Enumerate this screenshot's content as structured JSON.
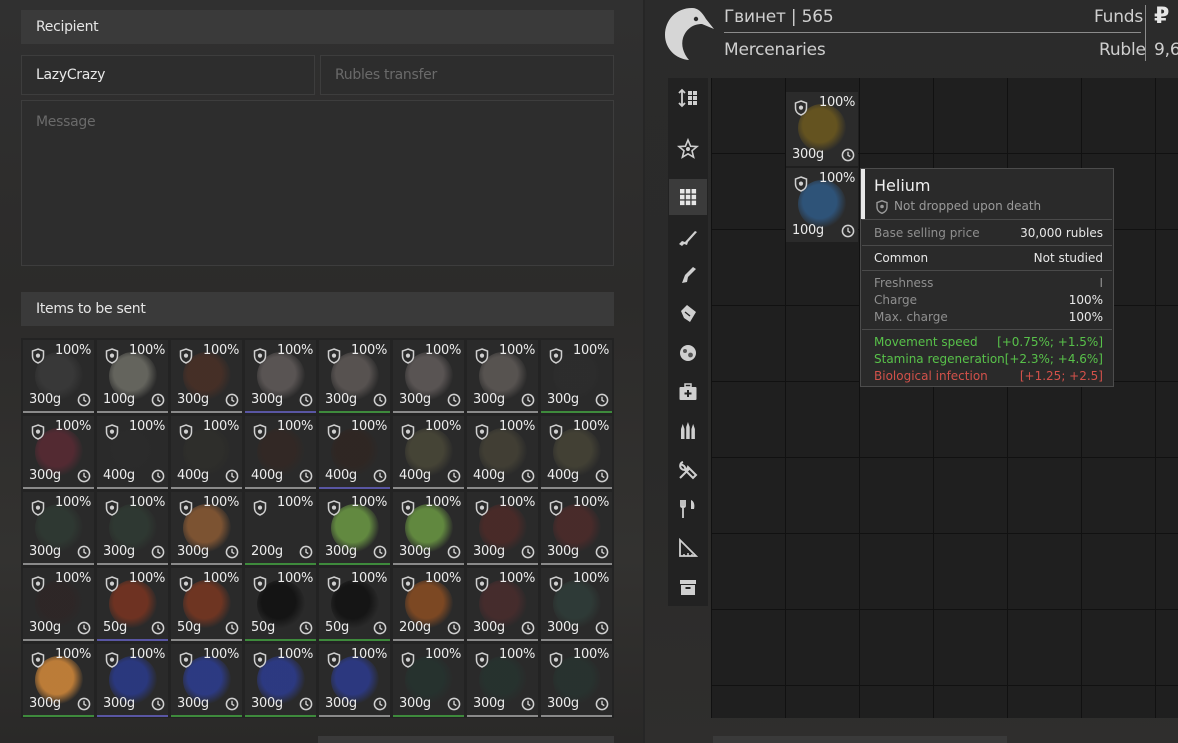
{
  "recipient": {
    "header": "Recipient",
    "username": "LazyCrazy",
    "rubles_placeholder": "Rubles transfer",
    "message_placeholder": "Message"
  },
  "items_to_send": {
    "header": "Items to be sent",
    "items": [
      {
        "pct": "100%",
        "weight": "300g",
        "color": "#3a3a3a",
        "edge": "gray"
      },
      {
        "pct": "100%",
        "weight": "100g",
        "color": "#6e6e66",
        "edge": "gray"
      },
      {
        "pct": "100%",
        "weight": "300g",
        "color": "#4a3026",
        "edge": "gray"
      },
      {
        "pct": "100%",
        "weight": "300g",
        "color": "#615b5a",
        "edge": "purple"
      },
      {
        "pct": "100%",
        "weight": "300g",
        "color": "#5f5957",
        "edge": "green"
      },
      {
        "pct": "100%",
        "weight": "300g",
        "color": "#615b5a",
        "edge": "gray"
      },
      {
        "pct": "100%",
        "weight": "300g",
        "color": "#5f5a57",
        "edge": "gray"
      },
      {
        "pct": "100%",
        "weight": "300g",
        "color": "#2d2d2d",
        "edge": "green"
      },
      {
        "pct": "100%",
        "weight": "300g",
        "color": "#5a2a34",
        "edge": "gray"
      },
      {
        "pct": "100%",
        "weight": "400g",
        "color": "#2b2b2b",
        "edge": "gray"
      },
      {
        "pct": "100%",
        "weight": "400g",
        "color": "#2f2f2b",
        "edge": "gray"
      },
      {
        "pct": "100%",
        "weight": "400g",
        "color": "#332824",
        "edge": "gray"
      },
      {
        "pct": "100%",
        "weight": "400g",
        "color": "#302622",
        "edge": "purple"
      },
      {
        "pct": "100%",
        "weight": "400g",
        "color": "#4a4838",
        "edge": "gray"
      },
      {
        "pct": "100%",
        "weight": "400g",
        "color": "#454236",
        "edge": "gray"
      },
      {
        "pct": "100%",
        "weight": "400g",
        "color": "#464436",
        "edge": "gray"
      },
      {
        "pct": "100%",
        "weight": "300g",
        "color": "#2f3a33",
        "edge": "gray"
      },
      {
        "pct": "100%",
        "weight": "300g",
        "color": "#2f3b33",
        "edge": "gray"
      },
      {
        "pct": "100%",
        "weight": "300g",
        "color": "#8a5a34",
        "edge": "gray"
      },
      {
        "pct": "100%",
        "weight": "200g",
        "color": "#2a2a2a",
        "edge": "green"
      },
      {
        "pct": "100%",
        "weight": "300g",
        "color": "#6c9a44",
        "edge": "green"
      },
      {
        "pct": "100%",
        "weight": "300g",
        "color": "#6b9843",
        "edge": "gray"
      },
      {
        "pct": "100%",
        "weight": "300g",
        "color": "#4e2a28",
        "edge": "gray"
      },
      {
        "pct": "100%",
        "weight": "300g",
        "color": "#4e2b2a",
        "edge": "gray"
      },
      {
        "pct": "100%",
        "weight": "300g",
        "color": "#2e2626",
        "edge": "gray"
      },
      {
        "pct": "100%",
        "weight": "50g",
        "color": "#7a3420",
        "edge": "purple"
      },
      {
        "pct": "100%",
        "weight": "50g",
        "color": "#7a3721",
        "edge": "gray"
      },
      {
        "pct": "100%",
        "weight": "50g",
        "color": "#101010",
        "edge": "green"
      },
      {
        "pct": "100%",
        "weight": "50g",
        "color": "#111111",
        "edge": "green"
      },
      {
        "pct": "100%",
        "weight": "200g",
        "color": "#8a4d22",
        "edge": "gray"
      },
      {
        "pct": "100%",
        "weight": "300g",
        "color": "#4a2c2d",
        "edge": "gray"
      },
      {
        "pct": "100%",
        "weight": "300g",
        "color": "#2f3d39",
        "edge": "gray"
      },
      {
        "pct": "100%",
        "weight": "300g",
        "color": "#d58a3a",
        "edge": "green"
      },
      {
        "pct": "100%",
        "weight": "300g",
        "color": "#2a3a8c",
        "edge": "purple"
      },
      {
        "pct": "100%",
        "weight": "300g",
        "color": "#2d3d92",
        "edge": "green"
      },
      {
        "pct": "100%",
        "weight": "300g",
        "color": "#2d3c90",
        "edge": "green"
      },
      {
        "pct": "100%",
        "weight": "300g",
        "color": "#2c3b8e",
        "edge": "gray"
      },
      {
        "pct": "100%",
        "weight": "300g",
        "color": "#25332f",
        "edge": "green"
      },
      {
        "pct": "100%",
        "weight": "300g",
        "color": "#26332f",
        "edge": "gray"
      },
      {
        "pct": "100%",
        "weight": "300g",
        "color": "#273430",
        "edge": "gray"
      }
    ]
  },
  "player": {
    "name_level": "Гвинет | 565",
    "faction": "Mercenaries",
    "funds_label": "Funds",
    "currency_label": "Ruble",
    "currency_symbol": "₽",
    "funds_value": "9,6"
  },
  "sidebar": [
    {
      "icon": "sort-icon",
      "active": false
    },
    {
      "icon": "favorite-star-icon",
      "active": false
    },
    {
      "icon": "all-items-grid-icon",
      "active": true
    },
    {
      "icon": "rifle-icon",
      "active": false
    },
    {
      "icon": "pistol-icon",
      "active": false
    },
    {
      "icon": "armor-icon",
      "active": false
    },
    {
      "icon": "artifact-icon",
      "active": false
    },
    {
      "icon": "medkit-icon",
      "active": false
    },
    {
      "icon": "ammo-icon",
      "active": false
    },
    {
      "icon": "tools-icon",
      "active": false
    },
    {
      "icon": "food-icon",
      "active": false
    },
    {
      "icon": "blueprint-ruler-icon",
      "active": false
    },
    {
      "icon": "misc-box-icon",
      "active": false
    }
  ],
  "inventory": [
    {
      "pct": "100%",
      "weight": "300g",
      "color": "#6e5a1e"
    },
    {
      "pct": "100%",
      "weight": "100g",
      "color": "#2f5a86"
    }
  ],
  "tooltip": {
    "title": "Helium",
    "subtitle": "Not dropped upon death",
    "base_price_label": "Base selling price",
    "base_price_value": "30,000 rubles",
    "rarity": "Common",
    "study_status": "Not studied",
    "freshness_label": "Freshness",
    "freshness_value": "I",
    "charge_label": "Charge",
    "charge_value": "100%",
    "max_charge_label": "Max. charge",
    "max_charge_value": "100%",
    "stats": [
      {
        "label": "Movement speed",
        "value": "[+0.75%; +1.5%]",
        "tone": "green"
      },
      {
        "label": "Stamina regeneration",
        "value": "[+2.3%; +4.6%]",
        "tone": "green"
      },
      {
        "label": "Biological infection",
        "value": "[+1.25; +2.5]",
        "tone": "red"
      }
    ]
  }
}
